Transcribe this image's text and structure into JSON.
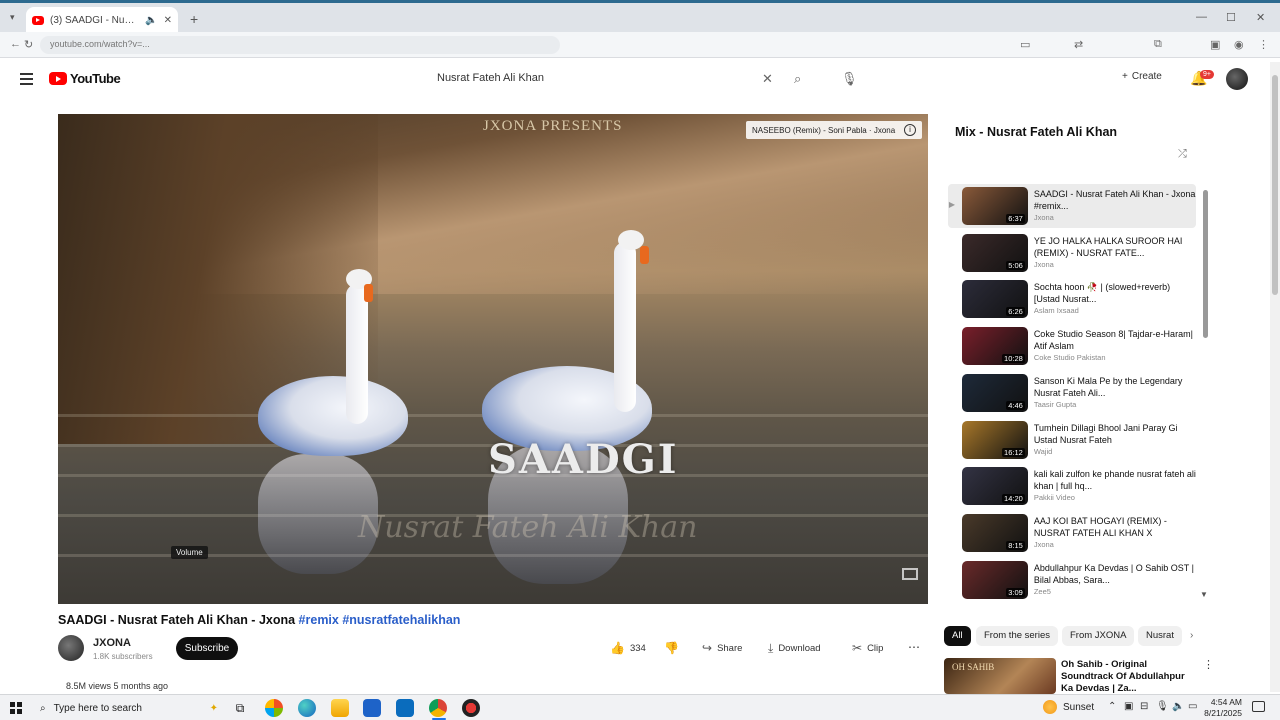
{
  "browser": {
    "tab_title": "(3) SAADGI - Nusrat F...",
    "url_text": "youtube.com/watch?v=...",
    "new_tab": "+",
    "menu": "▾",
    "close": "✕",
    "minimize": "—",
    "maximize": "☐"
  },
  "youtube": {
    "logo_text": "YouTube",
    "search_query": "Nusrat Fateh Ali Khan",
    "create_label": "Create",
    "notification_count": "9+"
  },
  "player": {
    "overlay_presents": "JXONA PRESENTS",
    "card_text": "NASEEBO (Remix) - Soni Pabla · Jxona",
    "big_title": "SAADGI",
    "script_text": "Nusrat Fateh Ali Khan",
    "volume_tooltip": "Volume"
  },
  "video": {
    "title_main": "SAADGI - Nusrat Fateh Ali Khan - Jxona ",
    "title_tags": "#remix #nusratfatehalikhan",
    "channel_name": "JXONA",
    "channel_subs": "1.8K subscribers",
    "subscribe_label": "Subscribe",
    "likes": "334",
    "share_label": "Share",
    "download_label": "Download",
    "clip_label": "Clip",
    "views_text": "8.5M views  5 months ago"
  },
  "mix": {
    "title": "Mix - Nusrat Fateh Ali Khan",
    "items": [
      {
        "title": "SAADGI - Nusrat Fateh Ali Khan - Jxona #remix...",
        "channel": "Jxona",
        "duration": "6:37",
        "color": "#8a5a3a"
      },
      {
        "title": "YE JO HALKA HALKA SUROOR HAI (REMIX) - NUSRAT FATE...",
        "channel": "Jxona",
        "duration": "5:06",
        "color": "#3b2a2a"
      },
      {
        "title": "Sochta hoon 🥀 | (slowed+reverb) [Ustad Nusrat...",
        "channel": "Aslam Ixsaad",
        "duration": "6:26",
        "color": "#2c2c3a"
      },
      {
        "title": "Coke Studio Season 8| Tajdar-e-Haram| Atif Aslam",
        "channel": "Coke Studio Pakistan",
        "duration": "10:28",
        "color": "#7a1f2b"
      },
      {
        "title": "Sanson Ki Mala Pe by the Legendary Nusrat Fateh Ali...",
        "channel": "Taasir Gupta",
        "duration": "4:46",
        "color": "#1e2a3a"
      },
      {
        "title": "Tumhein Dillagi Bhool Jani Paray Gi Ustad Nusrat Fateh",
        "channel": "Wajid",
        "duration": "16:12",
        "color": "#a8782a"
      },
      {
        "title": "kali kali zulfon ke phande nusrat fateh ali khan | full hq...",
        "channel": "Pakkii Video",
        "duration": "14:20",
        "color": "#333344"
      },
      {
        "title": "AAJ KOI BAT HOGAYI (REMIX) - NUSRAT FATEH ALI KHAN X",
        "channel": "Jxona",
        "duration": "8:15",
        "color": "#4a3a2a"
      },
      {
        "title": "Abdullahpur Ka Devdas | O Sahib OST | Bilal Abbas, Sara...",
        "channel": "Zee5",
        "duration": "3:09",
        "color": "#6a2a2a"
      }
    ]
  },
  "chips": [
    "All",
    "From the series",
    "From JXONA",
    "Nusrat"
  ],
  "recommendation": {
    "thumb_text": "OH SAHIB",
    "title": "Oh Sahib - Original Soundtrack Of Abdullahpur Ka Devdas | Za..."
  },
  "taskbar": {
    "search_placeholder": "Type here to search",
    "weather": "Sunset",
    "time": "4:54 AM",
    "date": "8/21/2025"
  }
}
